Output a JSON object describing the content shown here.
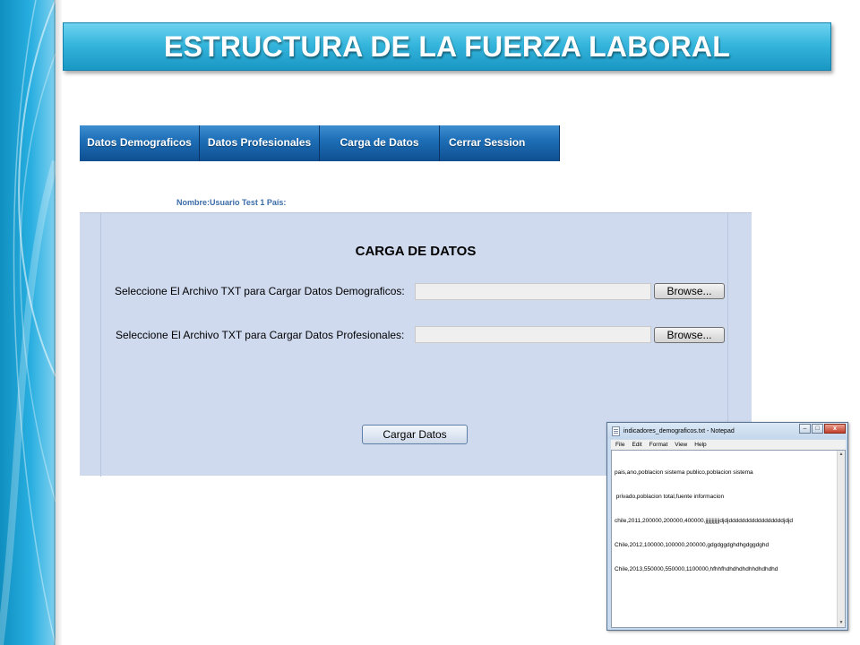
{
  "slide": {
    "title": "ESTRUCTURA DE LA FUERZA LABORAL"
  },
  "nav": {
    "items": [
      {
        "label": "Datos Demograficos"
      },
      {
        "label": "Datos Profesionales"
      },
      {
        "label": "Carga de Datos"
      },
      {
        "label": "Cerrar Session"
      }
    ]
  },
  "user": {
    "info": "Nombre:Usuario Test 1 País:"
  },
  "upload_form": {
    "heading": "CARGA DE DATOS",
    "demographic_label": "Seleccione El Archivo TXT para Cargar Datos Demograficos:",
    "professional_label": "Seleccione El Archivo TXT para Cargar Datos Profesionales:",
    "demographic_value": "",
    "professional_value": "",
    "browse_label": "Browse...",
    "submit_label": "Cargar Datos"
  },
  "notepad": {
    "title": "indicadores_demograficos.txt - Notepad",
    "controls": {
      "minimize": "–",
      "maximize": "□",
      "close": "x"
    },
    "menu": [
      "File",
      "Edit",
      "Format",
      "View",
      "Help"
    ],
    "lines": [
      "pais,ano,poblacion sistema publico,poblacion sistema",
      " privado,poblacion total,fuente informacion",
      "chile,2011,200000,200000,400000,jjjjjjjjjjjdjdjdddddddddddddddddjdjd",
      "Chile,2012,100000,100000,200000,gdgdggdghdhgdggdghd",
      "Chile,2013,550000,550000,1100000,hfhhfhdhdhdhdhhdhdhdhd"
    ],
    "scroll_up": "▲",
    "scroll_down": "▼"
  },
  "colors": {
    "title_band": "#35b6dd",
    "nav_blue": "#1e6fb7",
    "panel_bg": "#cfdaee",
    "user_text": "#3c6ca8"
  }
}
